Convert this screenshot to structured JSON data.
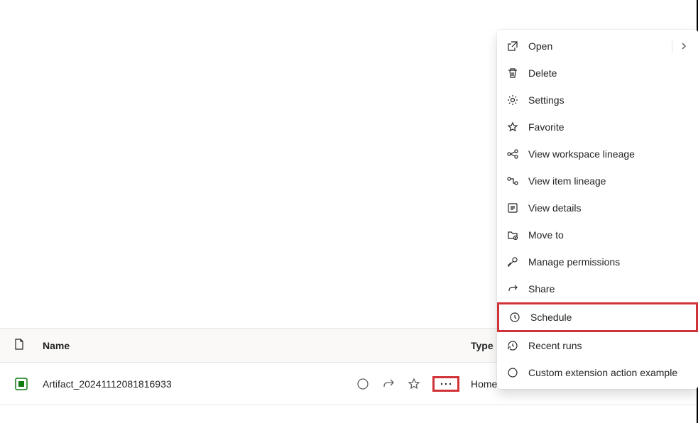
{
  "table": {
    "headers": {
      "name": "Name",
      "type": "Type"
    },
    "row": {
      "name": "Artifact_20241112081816933",
      "type": "HomeOne",
      "dash": "—"
    }
  },
  "contextMenu": {
    "items": [
      {
        "label": "Open",
        "icon": "open-icon",
        "hasSubmenu": true
      },
      {
        "label": "Delete",
        "icon": "delete-icon"
      },
      {
        "label": "Settings",
        "icon": "settings-icon"
      },
      {
        "label": "Favorite",
        "icon": "favorite-icon"
      },
      {
        "label": "View workspace lineage",
        "icon": "lineage-workspace-icon"
      },
      {
        "label": "View item lineage",
        "icon": "lineage-item-icon"
      },
      {
        "label": "View details",
        "icon": "details-icon"
      },
      {
        "label": "Move to",
        "icon": "moveto-icon"
      },
      {
        "label": "Manage permissions",
        "icon": "permissions-icon"
      },
      {
        "label": "Share",
        "icon": "share-icon"
      },
      {
        "label": "Schedule",
        "icon": "schedule-icon",
        "highlighted": true
      },
      {
        "label": "Recent runs",
        "icon": "recent-icon"
      },
      {
        "label": "Custom extension action example",
        "icon": "custom-icon"
      }
    ]
  }
}
